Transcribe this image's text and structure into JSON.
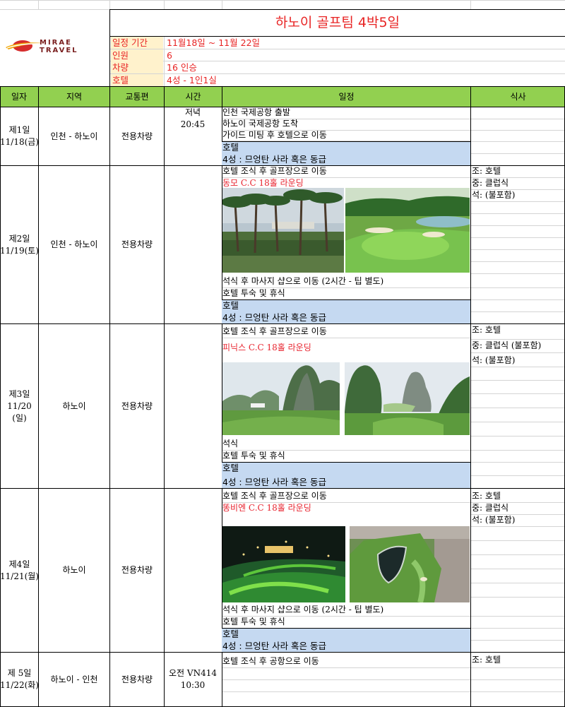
{
  "header": {
    "title": "하노이 골프팀 4박5일",
    "logo_line1": "MIRAE",
    "logo_line2": "TRAVEL",
    "info": [
      {
        "label": "일정 기간",
        "value": "11월18일 ~ 11월 22일"
      },
      {
        "label": "인원",
        "value": "6"
      },
      {
        "label": "차량",
        "value": "16 인승"
      },
      {
        "label": "호텔",
        "value": "4성 - 1인1실"
      }
    ]
  },
  "columns": [
    "일자",
    "지역",
    "교통편",
    "시간",
    "일정",
    "식사"
  ],
  "days": [
    {
      "day": "제1일",
      "date": "11/18(금)",
      "region": "인천 - 하노이",
      "transport": "전용차량",
      "time1": "저녁",
      "time2": "20:45",
      "schedule": [
        "인천 국제공항 출발",
        "하노이 국제공항 도착",
        "가이드 미팅 후 호텔으로 이동"
      ],
      "hotel_title": "호텔",
      "hotel_detail": "4성 : 므엉탄 사라 혹은 동급"
    },
    {
      "day": "제2일",
      "date": "11/19(토)",
      "region": "인천 - 하노이",
      "transport": "전용차량",
      "schedule_top": "호텔 조식 후 골프장으로 이동",
      "golf": "동모 C.C 18홀 라운딩",
      "schedule_after": [
        "석식 후 마사지 샵으로 이동 (2시간 - 팁 별도)",
        "호텔 투숙 및 휴식"
      ],
      "hotel_title": "호텔",
      "hotel_detail": "4성 : 므엉탄 사라 혹은 동급",
      "meals": [
        "조: 호텔",
        "중: 클럽식",
        "석: (불포함)"
      ]
    },
    {
      "day": "제3일",
      "date": "11/20",
      "weekday": "(일)",
      "region": "하노이",
      "transport": "전용차량",
      "schedule_top": "호텔 조식 후 골프장으로 이동",
      "golf": "피닉스 C.C 18홀 라운딩",
      "schedule_after": [
        "석식",
        "호텔 투숙 및 휴식"
      ],
      "hotel_title": "호텔",
      "hotel_detail": "4성 : 므엉탄 사라 혹은 동급",
      "meals": [
        "조: 호텔",
        "중: 클럽식  (불포함)",
        "석: (불포함)"
      ]
    },
    {
      "day": "제4일",
      "date": "11/21(월)",
      "region": "하노이",
      "transport": "전용차량",
      "schedule_top": "호텔 조식 후 골프장으로 이동",
      "golf": "똥비엔 C.C 18홀 라운딩",
      "schedule_after": [
        "석식 후 마사지 샵으로 이동 (2시간 - 팁 별도)",
        "호텔 투숙 및 휴식"
      ],
      "hotel_title": "호텔",
      "hotel_detail": "4성 : 므엉탄 사라 혹은 동급",
      "meals": [
        "조: 호텔",
        "중: 클럽식",
        "석: (불포함)"
      ]
    },
    {
      "day": "제 5일",
      "date": "11/22(화)",
      "region": "하노이 - 인천",
      "transport": "전용차량",
      "time1": "오전 VN414",
      "time2": "10:30",
      "schedule_top": "호텔 조식 후 공항으로 이동",
      "meals": [
        "조: 호텔"
      ]
    }
  ],
  "colors": {
    "header_green": "#92d050",
    "info_yellow": "#fff2cc",
    "hotel_blue": "#c5d9f1",
    "accent_red": "#e82424"
  }
}
